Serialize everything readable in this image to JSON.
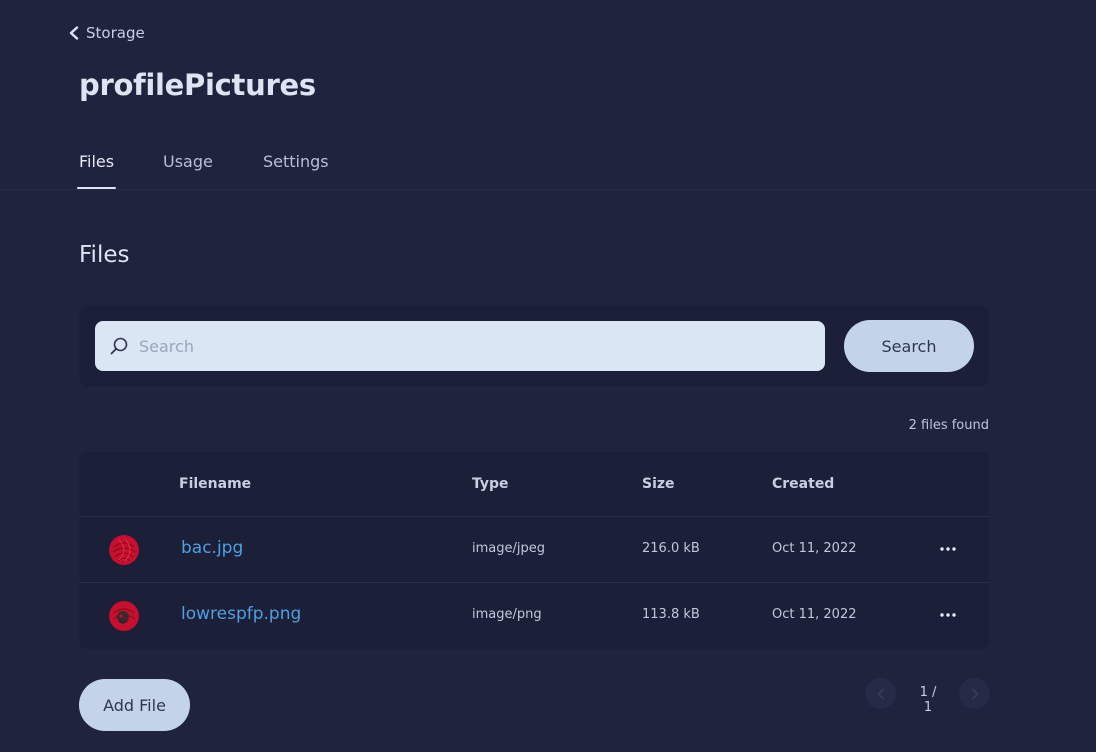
{
  "breadcrumb": {
    "label": "Storage"
  },
  "page_title": "profilePictures",
  "tabs": [
    {
      "label": "Files",
      "active": true
    },
    {
      "label": "Usage",
      "active": false
    },
    {
      "label": "Settings",
      "active": false
    }
  ],
  "section_title": "Files",
  "search": {
    "placeholder": "Search",
    "value": "",
    "button_label": "Search"
  },
  "files_count": "2 files found",
  "table": {
    "headers": {
      "filename": "Filename",
      "type": "Type",
      "size": "Size",
      "created": "Created"
    },
    "rows": [
      {
        "filename": "bac.jpg",
        "type": "image/jpeg",
        "size": "216.0 kB",
        "created": "Oct 11, 2022",
        "thumb_color": "#c8102e"
      },
      {
        "filename": "lowrespfp.png",
        "type": "image/png",
        "size": "113.8 kB",
        "created": "Oct 11, 2022",
        "thumb_color": "#c8102e"
      }
    ]
  },
  "add_file_label": "Add File",
  "pagination": {
    "label": "1 / 1"
  },
  "colors": {
    "background": "#1f233d",
    "panel": "#1b1f37",
    "accent_button": "#c3d4e9",
    "link": "#4ea0e0"
  }
}
